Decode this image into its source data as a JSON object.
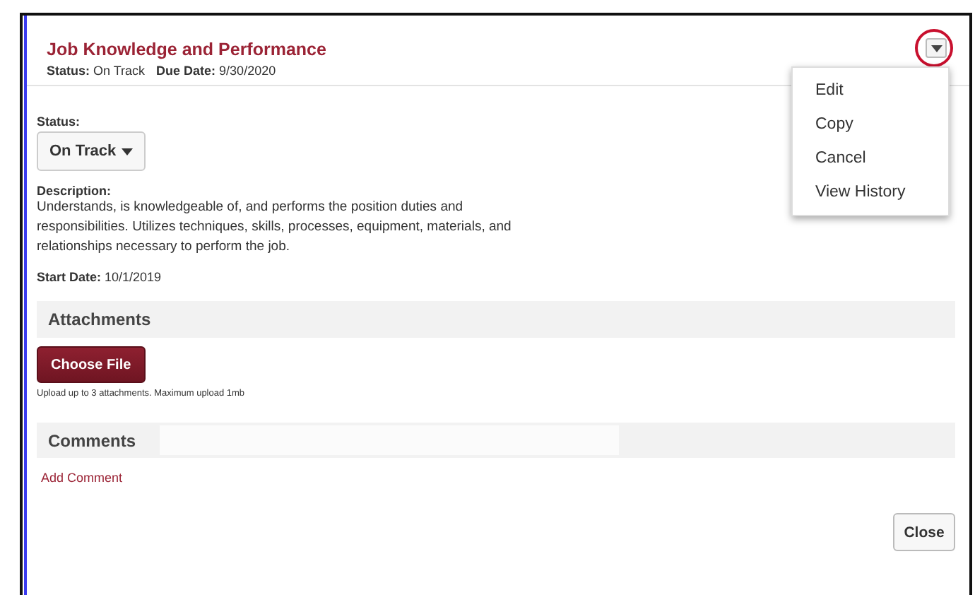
{
  "goal": {
    "title": "Job Knowledge and Performance",
    "summary": [
      "**Status:** On Track",
      "**Due Date:** 9/30/2020"
    ]
  },
  "actions_menu": {
    "expanded": true,
    "items": [
      "Edit",
      "Copy",
      "Cancel",
      "View History"
    ]
  },
  "status_field": {
    "label": "Status:",
    "value": "On Track"
  },
  "description": {
    "label": "Description:",
    "text": "Understands, is knowledgeable of, and performs the position duties and responsibilities. Utilizes techniques, skills, processes, equipment, materials, and relationships necessary to perform the job."
  },
  "start_date": "**Start Date:** 10/1/2019",
  "attachments": {
    "heading": "Attachments",
    "button": "Choose File",
    "hint": "Upload up to 3 attachments. Maximum upload 1mb"
  },
  "comments": {
    "heading": "Comments",
    "link": "Add Comment"
  },
  "buttons": [
    "Close"
  ]
}
